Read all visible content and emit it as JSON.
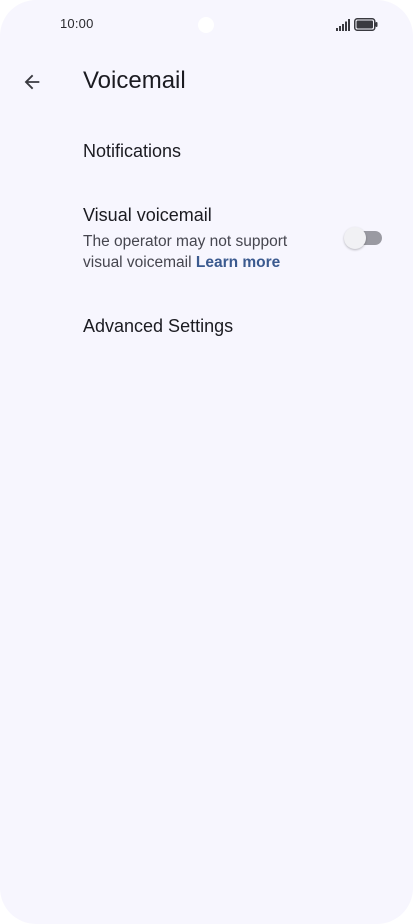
{
  "status_bar": {
    "time": "10:00",
    "icons": [
      "camera-cutout",
      "signal-icon",
      "battery-icon"
    ]
  },
  "app_bar": {
    "back_icon": "arrow-back-icon",
    "title": "Voicemail"
  },
  "settings": {
    "notifications": {
      "title": "Notifications"
    },
    "visual_voicemail": {
      "title": "Visual voicemail",
      "summary": "The operator may not support visual voicemail",
      "link": "Learn more",
      "enabled": false
    },
    "advanced": {
      "title": "Advanced Settings"
    }
  },
  "colors": {
    "background": "#f7f6fe",
    "text_primary": "#1b1b21",
    "text_secondary": "#46464f",
    "link": "#3b5a8f",
    "toggle_track_off": "#9a9aa2"
  }
}
